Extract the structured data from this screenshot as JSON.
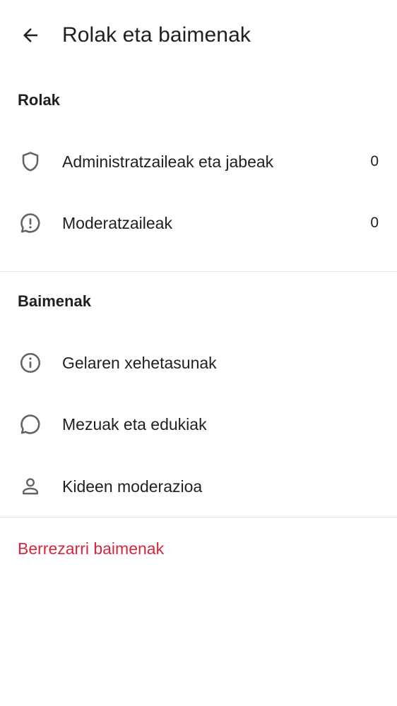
{
  "header": {
    "title": "Rolak eta baimenak",
    "back_icon": "arrow-left-icon"
  },
  "roles_section": {
    "title": "Rolak",
    "items": [
      {
        "label": "Administratzaileak eta jabeak",
        "count": "0",
        "icon": "shield-icon"
      },
      {
        "label": "Moderatzaileak",
        "count": "0",
        "icon": "message-alert-icon"
      }
    ]
  },
  "permissions_section": {
    "title": "Baimenak",
    "items": [
      {
        "label": "Gelaren xehetasunak",
        "icon": "info-icon"
      },
      {
        "label": "Mezuak eta edukiak",
        "icon": "chat-bubble-icon"
      },
      {
        "label": "Kideen moderazioa",
        "icon": "person-icon"
      }
    ]
  },
  "reset_label": "Berrezarri baimenak",
  "colors": {
    "text": "#1f1f1f",
    "icon": "#5f6368",
    "divider": "#e3e3e3",
    "danger": "#d6263d"
  }
}
